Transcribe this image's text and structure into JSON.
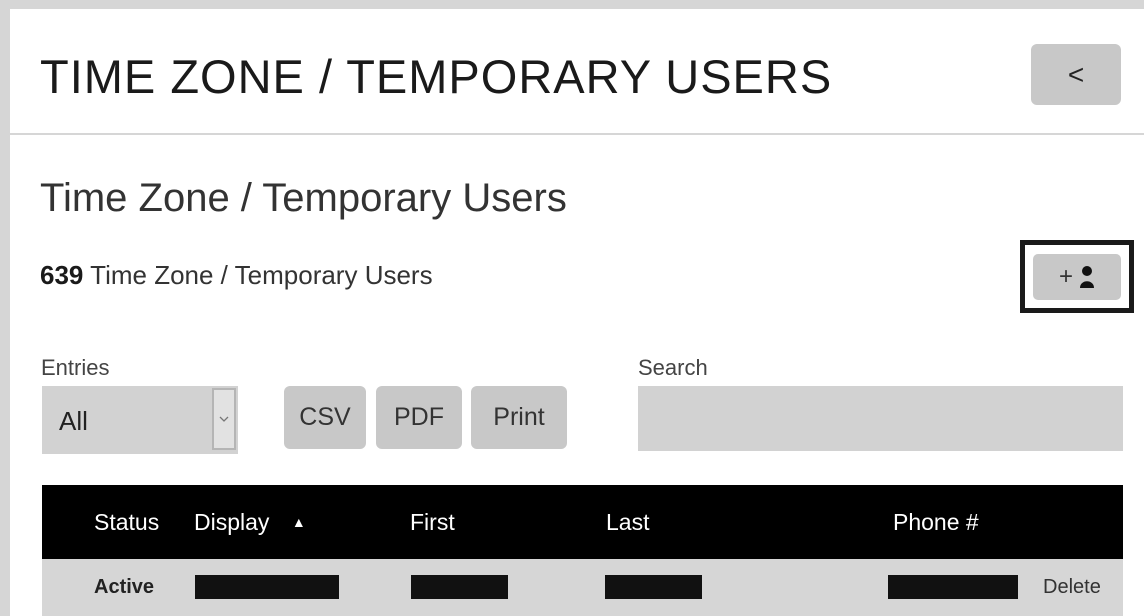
{
  "header": {
    "title": "TIME ZONE / TEMPORARY USERS",
    "back_icon": "chevron-left-icon",
    "back_glyph": "<"
  },
  "section": {
    "title": "Time Zone / Temporary Users",
    "count": "639",
    "count_label": "Time Zone / Temporary Users"
  },
  "add_user": {
    "plus": "+",
    "icon": "user-icon"
  },
  "entries": {
    "label": "Entries",
    "selected": "All"
  },
  "export_buttons": {
    "csv": "CSV",
    "pdf": "PDF",
    "print": "Print"
  },
  "search": {
    "label": "Search",
    "value": ""
  },
  "table": {
    "columns": {
      "status": "Status",
      "display": "Display",
      "first": "First",
      "last": "Last",
      "phone": "Phone #"
    },
    "sort_indicator": "▲",
    "rows": [
      {
        "status": "Active",
        "display": "[redacted]",
        "first": "[redacted]",
        "last": "[redacted]",
        "phone": "[redacted]",
        "action": "Delete"
      }
    ]
  },
  "colors": {
    "page_bg": "#d6d6d6",
    "button_bg": "#c8c8c8",
    "table_header_bg": "#000000",
    "row_bg": "#d6d6d6",
    "highlight_border": "#1a1a1a"
  }
}
